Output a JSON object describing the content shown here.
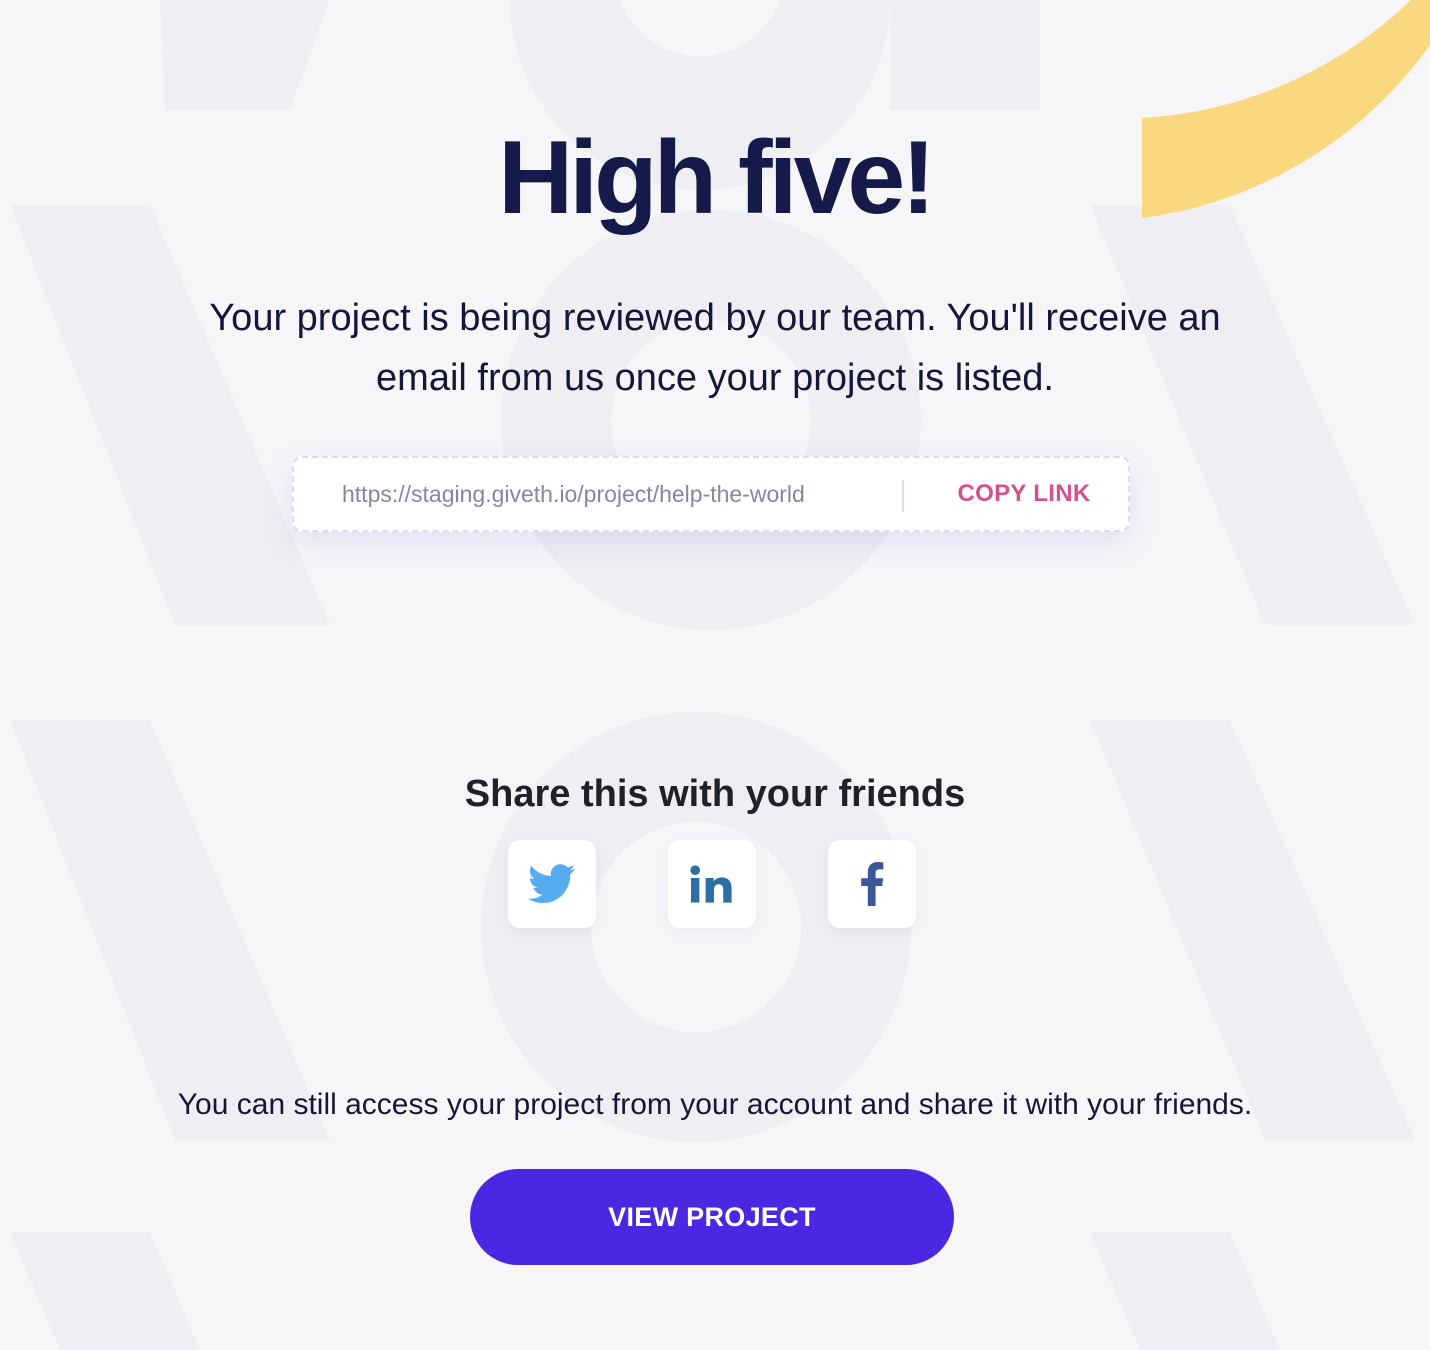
{
  "heading": "High five!",
  "message": "Your project is being reviewed by our team. You'll receive an email from us once your project is listed.",
  "share_link": {
    "url": "https://staging.giveth.io/project/help-the-world",
    "copy_label": "COPY LINK"
  },
  "share": {
    "title": "Share this with your friends",
    "buttons": [
      {
        "network": "Twitter",
        "icon": "twitter-icon",
        "color": "#55acee"
      },
      {
        "network": "LinkedIn",
        "icon": "linkedin-icon",
        "color": "#2c6fa5"
      },
      {
        "network": "Facebook",
        "icon": "facebook-icon",
        "color": "#3b5998"
      }
    ]
  },
  "footer": {
    "text": "You can still access your project from your account and share it with your friends.",
    "button_label": "VIEW PROJECT"
  },
  "colors": {
    "background": "#f6f6f9",
    "accent_arc": "#f9d87f",
    "primary_button": "#4b27e2",
    "copy_link": "#d5518c",
    "heading": "#161a4a"
  }
}
